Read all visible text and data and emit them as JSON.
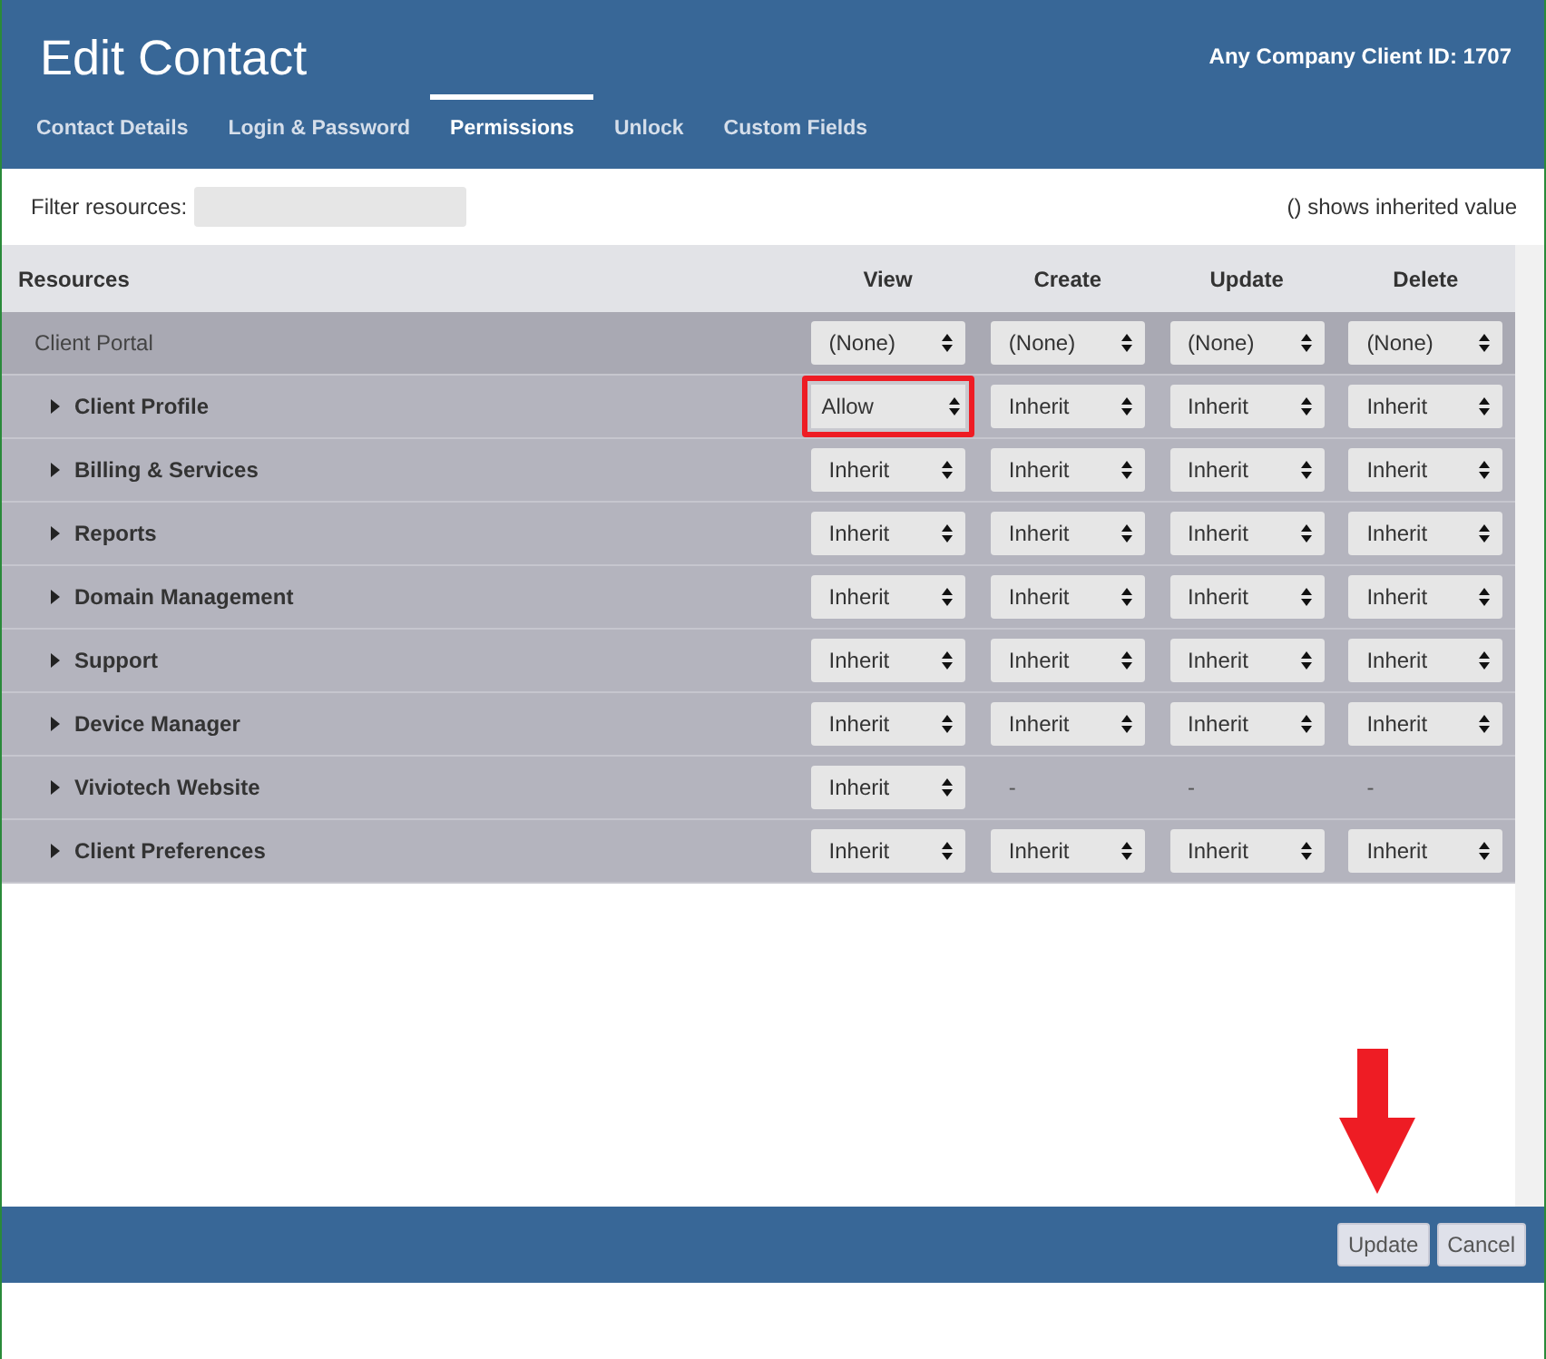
{
  "window": {
    "title": "Edit Contact",
    "client_id": "Any Company Client ID: 1707"
  },
  "tabs": [
    {
      "label": "Contact Details",
      "selected": false
    },
    {
      "label": "Login & Password",
      "selected": false
    },
    {
      "label": "Permissions",
      "selected": true
    },
    {
      "label": "Unlock",
      "selected": false
    },
    {
      "label": "Custom Fields",
      "selected": false
    }
  ],
  "filter": {
    "label": "Filter resources:"
  },
  "legend": "() shows inherited value",
  "table": {
    "resource_header": "Resources",
    "columns": [
      "View",
      "Create",
      "Update",
      "Delete"
    ],
    "rows": [
      {
        "kind": "group",
        "name": "Client Portal",
        "cells": [
          {
            "kind": "select",
            "value": "(None)",
            "highlighted": false
          },
          {
            "kind": "select",
            "value": "(None)",
            "highlighted": false
          },
          {
            "kind": "select",
            "value": "(None)",
            "highlighted": false
          },
          {
            "kind": "select",
            "value": "(None)",
            "highlighted": false
          }
        ]
      },
      {
        "kind": "item",
        "name": "Client Profile",
        "cells": [
          {
            "kind": "select",
            "value": "Allow",
            "highlighted": true
          },
          {
            "kind": "select",
            "value": "Inherit",
            "highlighted": false
          },
          {
            "kind": "select",
            "value": "Inherit",
            "highlighted": false
          },
          {
            "kind": "select",
            "value": "Inherit",
            "highlighted": false
          }
        ]
      },
      {
        "kind": "item",
        "name": "Billing & Services",
        "cells": [
          {
            "kind": "select",
            "value": "Inherit",
            "highlighted": false
          },
          {
            "kind": "select",
            "value": "Inherit",
            "highlighted": false
          },
          {
            "kind": "select",
            "value": "Inherit",
            "highlighted": false
          },
          {
            "kind": "select",
            "value": "Inherit",
            "highlighted": false
          }
        ]
      },
      {
        "kind": "item",
        "name": "Reports",
        "cells": [
          {
            "kind": "select",
            "value": "Inherit",
            "highlighted": false
          },
          {
            "kind": "select",
            "value": "Inherit",
            "highlighted": false
          },
          {
            "kind": "select",
            "value": "Inherit",
            "highlighted": false
          },
          {
            "kind": "select",
            "value": "Inherit",
            "highlighted": false
          }
        ]
      },
      {
        "kind": "item",
        "name": "Domain Management",
        "cells": [
          {
            "kind": "select",
            "value": "Inherit",
            "highlighted": false
          },
          {
            "kind": "select",
            "value": "Inherit",
            "highlighted": false
          },
          {
            "kind": "select",
            "value": "Inherit",
            "highlighted": false
          },
          {
            "kind": "select",
            "value": "Inherit",
            "highlighted": false
          }
        ]
      },
      {
        "kind": "item",
        "name": "Support",
        "cells": [
          {
            "kind": "select",
            "value": "Inherit",
            "highlighted": false
          },
          {
            "kind": "select",
            "value": "Inherit",
            "highlighted": false
          },
          {
            "kind": "select",
            "value": "Inherit",
            "highlighted": false
          },
          {
            "kind": "select",
            "value": "Inherit",
            "highlighted": false
          }
        ]
      },
      {
        "kind": "item",
        "name": "Device Manager",
        "cells": [
          {
            "kind": "select",
            "value": "Inherit",
            "highlighted": false
          },
          {
            "kind": "select",
            "value": "Inherit",
            "highlighted": false
          },
          {
            "kind": "select",
            "value": "Inherit",
            "highlighted": false
          },
          {
            "kind": "select",
            "value": "Inherit",
            "highlighted": false
          }
        ]
      },
      {
        "kind": "item",
        "name": "Viviotech Website",
        "cells": [
          {
            "kind": "select",
            "value": "Inherit",
            "highlighted": false
          },
          {
            "kind": "dash",
            "value": "-"
          },
          {
            "kind": "dash",
            "value": "-"
          },
          {
            "kind": "dash",
            "value": "-"
          }
        ]
      },
      {
        "kind": "item",
        "name": "Client Preferences",
        "cells": [
          {
            "kind": "select",
            "value": "Inherit",
            "highlighted": false
          },
          {
            "kind": "select",
            "value": "Inherit",
            "highlighted": false
          },
          {
            "kind": "select",
            "value": "Inherit",
            "highlighted": false
          },
          {
            "kind": "select",
            "value": "Inherit",
            "highlighted": false
          }
        ]
      }
    ]
  },
  "buttons": [
    "Update",
    "Cancel"
  ]
}
